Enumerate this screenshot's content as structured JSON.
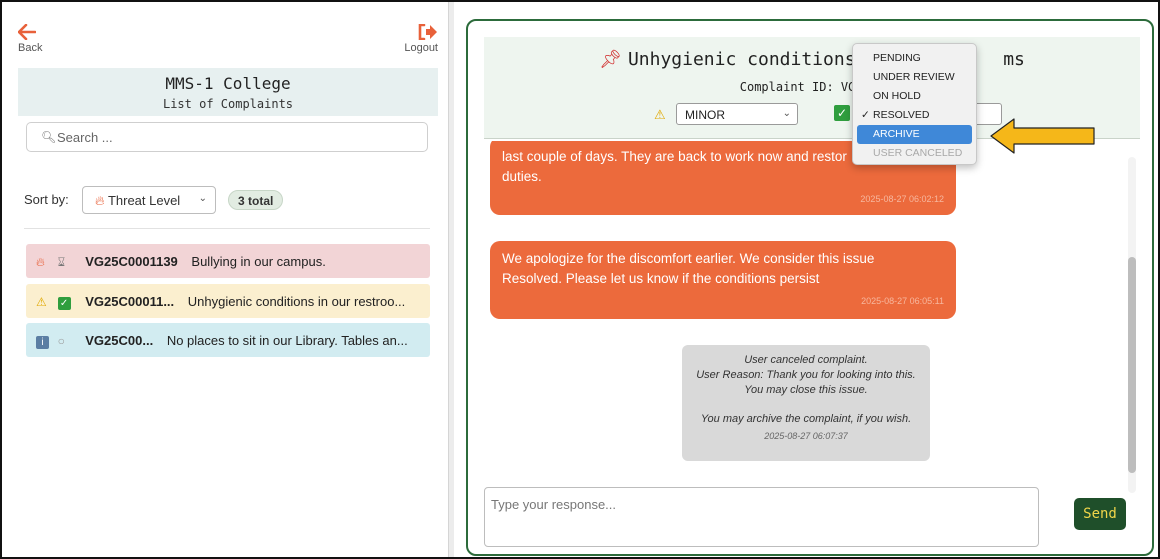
{
  "nav": {
    "back_label": "Back",
    "logout_label": "Logout"
  },
  "college": {
    "name": "MMS-1 College",
    "subtitle": "List of Complaints"
  },
  "search": {
    "placeholder": "Search ..."
  },
  "sort": {
    "label": "Sort by:",
    "selected": "Threat Level",
    "total_badge": "3 total"
  },
  "complaints": [
    {
      "threat_icon": "fire-icon",
      "status_icon": "hourglass-icon",
      "id": "VG25C0001139",
      "text": "Bullying in our campus."
    },
    {
      "threat_icon": "warning-icon",
      "status_icon": "check-icon",
      "id": "VG25C00011...",
      "text": "Unhygienic conditions in our restroo..."
    },
    {
      "threat_icon": "info-icon",
      "status_icon": "clock-icon",
      "id": "VG25C00...",
      "text": "No places to sit in our Library. Tables an..."
    }
  ],
  "detail": {
    "title": "Unhygienic conditions i",
    "title_tail": "ms",
    "complaint_id": "Complaint ID: VG25 C",
    "severity_selected": "MINOR"
  },
  "status_menu": {
    "options": [
      "PENDING",
      "UNDER REVIEW",
      "ON HOLD",
      "RESOLVED",
      "ARCHIVE",
      "USER CANCELED"
    ],
    "checked": "RESOLVED",
    "highlighted": "ARCHIVE",
    "disabled": "USER CANCELED"
  },
  "messages": [
    {
      "text_line1": "last couple of days. They are back to work now and restor",
      "text_line2": "duties.",
      "timestamp": "2025-08-27 06:02:12"
    },
    {
      "text_line1": "We apologize for the discomfort earlier. We consider this issue",
      "text_line2": "Resolved. Please let us know if the conditions persist",
      "timestamp": "2025-08-27 06:05:11"
    }
  ],
  "system_message": {
    "line1": "User canceled complaint.",
    "line2": "User Reason: Thank you for looking into this.",
    "line3": "You may close this issue.",
    "line4": "You may archive the complaint, if you wish.",
    "timestamp": "2025-08-27 06:07:37"
  },
  "reply": {
    "placeholder": "Type your response...",
    "send_label": "Send"
  },
  "colors": {
    "accent_green": "#2c6b3b",
    "bubble_orange": "#ec6a3c",
    "send_bg": "#1f4f2a",
    "send_text": "#f0d64a",
    "arrow_yellow": "#f5b719"
  }
}
